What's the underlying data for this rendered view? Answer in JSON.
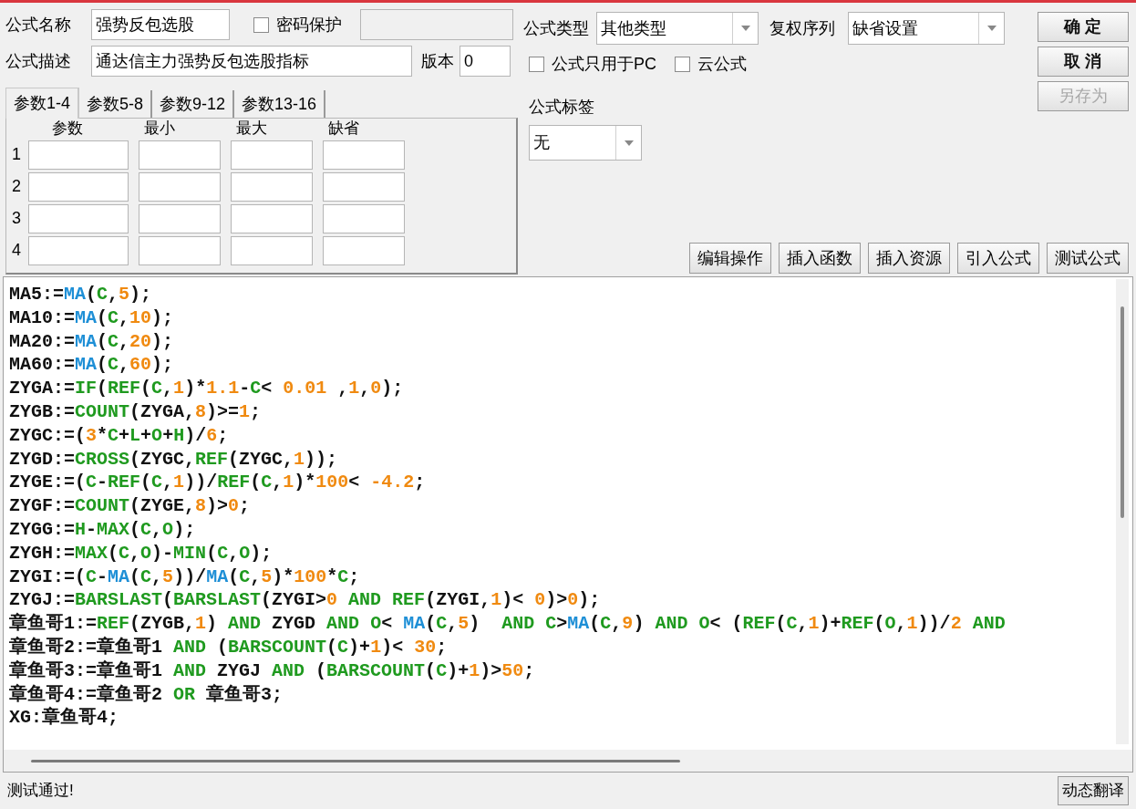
{
  "fields": {
    "name": {
      "label": "公式名称",
      "value": "强势反包选股"
    },
    "password": {
      "label": "密码保护",
      "checked": false
    },
    "description": {
      "label": "公式描述",
      "value": "通达信主力强势反包选股指标"
    },
    "version": {
      "label": "版本",
      "value": "0"
    },
    "type": {
      "label": "公式类型",
      "value": "其他类型"
    },
    "adjust": {
      "label": "复权序列",
      "value": "缺省设置"
    },
    "pc_only": {
      "label": "公式只用于PC",
      "checked": false
    },
    "cloud": {
      "label": "云公式",
      "checked": false
    },
    "tag": {
      "label": "公式标签",
      "value": "无"
    }
  },
  "param_tabs": [
    {
      "label": "参数1-4",
      "selected": true
    },
    {
      "label": "参数5-8",
      "selected": false
    },
    {
      "label": "参数9-12",
      "selected": false
    },
    {
      "label": "参数13-16",
      "selected": false
    }
  ],
  "param_table": {
    "columns": [
      "参数",
      "最小",
      "最大",
      "缺省"
    ],
    "rows": [
      "1",
      "2",
      "3",
      "4"
    ]
  },
  "dialog_buttons": [
    {
      "label": "确 定",
      "disabled": false
    },
    {
      "label": "取 消",
      "disabled": false
    },
    {
      "label": "另存为",
      "disabled": true
    }
  ],
  "tool_buttons": [
    "编辑操作",
    "插入函数",
    "插入资源",
    "引入公式",
    "测试公式"
  ],
  "code_lines": [
    [
      {
        "text": "MA5:=",
        "kind": "plain"
      },
      {
        "text": "MA",
        "kind": "func"
      },
      {
        "text": "(",
        "kind": "plain"
      },
      {
        "text": "C",
        "kind": "keyword"
      },
      {
        "text": ",",
        "kind": "plain"
      },
      {
        "text": "5",
        "kind": "number"
      },
      {
        "text": ");",
        "kind": "plain"
      }
    ],
    [
      {
        "text": "MA10:=",
        "kind": "plain"
      },
      {
        "text": "MA",
        "kind": "func"
      },
      {
        "text": "(",
        "kind": "plain"
      },
      {
        "text": "C",
        "kind": "keyword"
      },
      {
        "text": ",",
        "kind": "plain"
      },
      {
        "text": "10",
        "kind": "number"
      },
      {
        "text": ");",
        "kind": "plain"
      }
    ],
    [
      {
        "text": "MA20:=",
        "kind": "plain"
      },
      {
        "text": "MA",
        "kind": "func"
      },
      {
        "text": "(",
        "kind": "plain"
      },
      {
        "text": "C",
        "kind": "keyword"
      },
      {
        "text": ",",
        "kind": "plain"
      },
      {
        "text": "20",
        "kind": "number"
      },
      {
        "text": ");",
        "kind": "plain"
      }
    ],
    [
      {
        "text": "MA60:=",
        "kind": "plain"
      },
      {
        "text": "MA",
        "kind": "func"
      },
      {
        "text": "(",
        "kind": "plain"
      },
      {
        "text": "C",
        "kind": "keyword"
      },
      {
        "text": ",",
        "kind": "plain"
      },
      {
        "text": "60",
        "kind": "number"
      },
      {
        "text": ");",
        "kind": "plain"
      }
    ],
    [
      {
        "text": "ZYGA:=",
        "kind": "plain"
      },
      {
        "text": "IF",
        "kind": "keyword"
      },
      {
        "text": "(",
        "kind": "plain"
      },
      {
        "text": "REF",
        "kind": "keyword"
      },
      {
        "text": "(",
        "kind": "plain"
      },
      {
        "text": "C",
        "kind": "keyword"
      },
      {
        "text": ",",
        "kind": "plain"
      },
      {
        "text": "1",
        "kind": "number"
      },
      {
        "text": ")*",
        "kind": "plain"
      },
      {
        "text": "1.1",
        "kind": "number"
      },
      {
        "text": "-",
        "kind": "plain"
      },
      {
        "text": "C",
        "kind": "keyword"
      },
      {
        "text": "< ",
        "kind": "plain"
      },
      {
        "text": "0.01",
        "kind": "number"
      },
      {
        "text": " ,",
        "kind": "plain"
      },
      {
        "text": "1",
        "kind": "number"
      },
      {
        "text": ",",
        "kind": "plain"
      },
      {
        "text": "0",
        "kind": "number"
      },
      {
        "text": ");",
        "kind": "plain"
      }
    ],
    [
      {
        "text": "ZYGB:=",
        "kind": "plain"
      },
      {
        "text": "COUNT",
        "kind": "keyword"
      },
      {
        "text": "(ZYGA,",
        "kind": "plain"
      },
      {
        "text": "8",
        "kind": "number"
      },
      {
        "text": ")>=",
        "kind": "plain"
      },
      {
        "text": "1",
        "kind": "number"
      },
      {
        "text": ";",
        "kind": "plain"
      }
    ],
    [
      {
        "text": "ZYGC:=(",
        "kind": "plain"
      },
      {
        "text": "3",
        "kind": "number"
      },
      {
        "text": "*",
        "kind": "plain"
      },
      {
        "text": "C",
        "kind": "keyword"
      },
      {
        "text": "+",
        "kind": "plain"
      },
      {
        "text": "L",
        "kind": "keyword"
      },
      {
        "text": "+",
        "kind": "plain"
      },
      {
        "text": "O",
        "kind": "keyword"
      },
      {
        "text": "+",
        "kind": "plain"
      },
      {
        "text": "H",
        "kind": "keyword"
      },
      {
        "text": ")/",
        "kind": "plain"
      },
      {
        "text": "6",
        "kind": "number"
      },
      {
        "text": ";",
        "kind": "plain"
      }
    ],
    [
      {
        "text": "ZYGD:=",
        "kind": "plain"
      },
      {
        "text": "CROSS",
        "kind": "keyword"
      },
      {
        "text": "(ZYGC,",
        "kind": "plain"
      },
      {
        "text": "REF",
        "kind": "keyword"
      },
      {
        "text": "(ZYGC,",
        "kind": "plain"
      },
      {
        "text": "1",
        "kind": "number"
      },
      {
        "text": "));",
        "kind": "plain"
      }
    ],
    [
      {
        "text": "ZYGE:=(",
        "kind": "plain"
      },
      {
        "text": "C",
        "kind": "keyword"
      },
      {
        "text": "-",
        "kind": "plain"
      },
      {
        "text": "REF",
        "kind": "keyword"
      },
      {
        "text": "(",
        "kind": "plain"
      },
      {
        "text": "C",
        "kind": "keyword"
      },
      {
        "text": ",",
        "kind": "plain"
      },
      {
        "text": "1",
        "kind": "number"
      },
      {
        "text": "))/",
        "kind": "plain"
      },
      {
        "text": "REF",
        "kind": "keyword"
      },
      {
        "text": "(",
        "kind": "plain"
      },
      {
        "text": "C",
        "kind": "keyword"
      },
      {
        "text": ",",
        "kind": "plain"
      },
      {
        "text": "1",
        "kind": "number"
      },
      {
        "text": ")*",
        "kind": "plain"
      },
      {
        "text": "100",
        "kind": "number"
      },
      {
        "text": "< ",
        "kind": "plain"
      },
      {
        "text": "-4.2",
        "kind": "number"
      },
      {
        "text": ";",
        "kind": "plain"
      }
    ],
    [
      {
        "text": "ZYGF:=",
        "kind": "plain"
      },
      {
        "text": "COUNT",
        "kind": "keyword"
      },
      {
        "text": "(ZYGE,",
        "kind": "plain"
      },
      {
        "text": "8",
        "kind": "number"
      },
      {
        "text": ")>",
        "kind": "plain"
      },
      {
        "text": "0",
        "kind": "number"
      },
      {
        "text": ";",
        "kind": "plain"
      }
    ],
    [
      {
        "text": "ZYGG:=",
        "kind": "plain"
      },
      {
        "text": "H",
        "kind": "keyword"
      },
      {
        "text": "-",
        "kind": "plain"
      },
      {
        "text": "MAX",
        "kind": "keyword"
      },
      {
        "text": "(",
        "kind": "plain"
      },
      {
        "text": "C",
        "kind": "keyword"
      },
      {
        "text": ",",
        "kind": "plain"
      },
      {
        "text": "O",
        "kind": "keyword"
      },
      {
        "text": ");",
        "kind": "plain"
      }
    ],
    [
      {
        "text": "ZYGH:=",
        "kind": "plain"
      },
      {
        "text": "MAX",
        "kind": "keyword"
      },
      {
        "text": "(",
        "kind": "plain"
      },
      {
        "text": "C",
        "kind": "keyword"
      },
      {
        "text": ",",
        "kind": "plain"
      },
      {
        "text": "O",
        "kind": "keyword"
      },
      {
        "text": ")-",
        "kind": "plain"
      },
      {
        "text": "MIN",
        "kind": "keyword"
      },
      {
        "text": "(",
        "kind": "plain"
      },
      {
        "text": "C",
        "kind": "keyword"
      },
      {
        "text": ",",
        "kind": "plain"
      },
      {
        "text": "O",
        "kind": "keyword"
      },
      {
        "text": ");",
        "kind": "plain"
      }
    ],
    [
      {
        "text": "ZYGI:=(",
        "kind": "plain"
      },
      {
        "text": "C",
        "kind": "keyword"
      },
      {
        "text": "-",
        "kind": "plain"
      },
      {
        "text": "MA",
        "kind": "func"
      },
      {
        "text": "(",
        "kind": "plain"
      },
      {
        "text": "C",
        "kind": "keyword"
      },
      {
        "text": ",",
        "kind": "plain"
      },
      {
        "text": "5",
        "kind": "number"
      },
      {
        "text": "))/",
        "kind": "plain"
      },
      {
        "text": "MA",
        "kind": "func"
      },
      {
        "text": "(",
        "kind": "plain"
      },
      {
        "text": "C",
        "kind": "keyword"
      },
      {
        "text": ",",
        "kind": "plain"
      },
      {
        "text": "5",
        "kind": "number"
      },
      {
        "text": ")*",
        "kind": "plain"
      },
      {
        "text": "100",
        "kind": "number"
      },
      {
        "text": "*",
        "kind": "plain"
      },
      {
        "text": "C",
        "kind": "keyword"
      },
      {
        "text": ";",
        "kind": "plain"
      }
    ],
    [
      {
        "text": "ZYGJ:=",
        "kind": "plain"
      },
      {
        "text": "BARSLAST",
        "kind": "keyword"
      },
      {
        "text": "(",
        "kind": "plain"
      },
      {
        "text": "BARSLAST",
        "kind": "keyword"
      },
      {
        "text": "(ZYGI>",
        "kind": "plain"
      },
      {
        "text": "0",
        "kind": "number"
      },
      {
        "text": " AND ",
        "kind": "keyword"
      },
      {
        "text": "REF",
        "kind": "keyword"
      },
      {
        "text": "(ZYGI,",
        "kind": "plain"
      },
      {
        "text": "1",
        "kind": "number"
      },
      {
        "text": ")< ",
        "kind": "plain"
      },
      {
        "text": "0",
        "kind": "number"
      },
      {
        "text": ")>",
        "kind": "plain"
      },
      {
        "text": "0",
        "kind": "number"
      },
      {
        "text": ");",
        "kind": "plain"
      }
    ],
    [
      {
        "text": "章鱼哥1:=",
        "kind": "plain"
      },
      {
        "text": "REF",
        "kind": "keyword"
      },
      {
        "text": "(ZYGB,",
        "kind": "plain"
      },
      {
        "text": "1",
        "kind": "number"
      },
      {
        "text": ") ",
        "kind": "plain"
      },
      {
        "text": "AND",
        "kind": "keyword"
      },
      {
        "text": " ZYGD ",
        "kind": "plain"
      },
      {
        "text": "AND ",
        "kind": "keyword"
      },
      {
        "text": "O",
        "kind": "keyword"
      },
      {
        "text": "< ",
        "kind": "plain"
      },
      {
        "text": "MA",
        "kind": "func"
      },
      {
        "text": "(",
        "kind": "plain"
      },
      {
        "text": "C",
        "kind": "keyword"
      },
      {
        "text": ",",
        "kind": "plain"
      },
      {
        "text": "5",
        "kind": "number"
      },
      {
        "text": ")  ",
        "kind": "plain"
      },
      {
        "text": "AND ",
        "kind": "keyword"
      },
      {
        "text": "C",
        "kind": "keyword"
      },
      {
        "text": ">",
        "kind": "plain"
      },
      {
        "text": "MA",
        "kind": "func"
      },
      {
        "text": "(",
        "kind": "plain"
      },
      {
        "text": "C",
        "kind": "keyword"
      },
      {
        "text": ",",
        "kind": "plain"
      },
      {
        "text": "9",
        "kind": "number"
      },
      {
        "text": ") ",
        "kind": "plain"
      },
      {
        "text": "AND ",
        "kind": "keyword"
      },
      {
        "text": "O",
        "kind": "keyword"
      },
      {
        "text": "< (",
        "kind": "plain"
      },
      {
        "text": "REF",
        "kind": "keyword"
      },
      {
        "text": "(",
        "kind": "plain"
      },
      {
        "text": "C",
        "kind": "keyword"
      },
      {
        "text": ",",
        "kind": "plain"
      },
      {
        "text": "1",
        "kind": "number"
      },
      {
        "text": ")+",
        "kind": "plain"
      },
      {
        "text": "REF",
        "kind": "keyword"
      },
      {
        "text": "(",
        "kind": "plain"
      },
      {
        "text": "O",
        "kind": "keyword"
      },
      {
        "text": ",",
        "kind": "plain"
      },
      {
        "text": "1",
        "kind": "number"
      },
      {
        "text": "))/",
        "kind": "plain"
      },
      {
        "text": "2",
        "kind": "number"
      },
      {
        "text": " AND",
        "kind": "keyword"
      }
    ],
    [
      {
        "text": "章鱼哥2:=章鱼哥1 ",
        "kind": "plain"
      },
      {
        "text": "AND",
        "kind": "keyword"
      },
      {
        "text": " (",
        "kind": "plain"
      },
      {
        "text": "BARSCOUNT",
        "kind": "keyword"
      },
      {
        "text": "(",
        "kind": "plain"
      },
      {
        "text": "C",
        "kind": "keyword"
      },
      {
        "text": ")+",
        "kind": "plain"
      },
      {
        "text": "1",
        "kind": "number"
      },
      {
        "text": ")< ",
        "kind": "plain"
      },
      {
        "text": "30",
        "kind": "number"
      },
      {
        "text": ";",
        "kind": "plain"
      }
    ],
    [
      {
        "text": "章鱼哥3:=章鱼哥1 ",
        "kind": "plain"
      },
      {
        "text": "AND",
        "kind": "keyword"
      },
      {
        "text": " ZYGJ ",
        "kind": "plain"
      },
      {
        "text": "AND",
        "kind": "keyword"
      },
      {
        "text": " (",
        "kind": "plain"
      },
      {
        "text": "BARSCOUNT",
        "kind": "keyword"
      },
      {
        "text": "(",
        "kind": "plain"
      },
      {
        "text": "C",
        "kind": "keyword"
      },
      {
        "text": ")+",
        "kind": "plain"
      },
      {
        "text": "1",
        "kind": "number"
      },
      {
        "text": ")>",
        "kind": "plain"
      },
      {
        "text": "50",
        "kind": "number"
      },
      {
        "text": ";",
        "kind": "plain"
      }
    ],
    [
      {
        "text": "章鱼哥4:=章鱼哥2 ",
        "kind": "plain"
      },
      {
        "text": "OR",
        "kind": "keyword"
      },
      {
        "text": " 章鱼哥3;",
        "kind": "plain"
      }
    ],
    [
      {
        "text": "XG:章鱼哥4;",
        "kind": "plain"
      }
    ]
  ],
  "status": "测试通过!",
  "translate_button": "动态翻译"
}
